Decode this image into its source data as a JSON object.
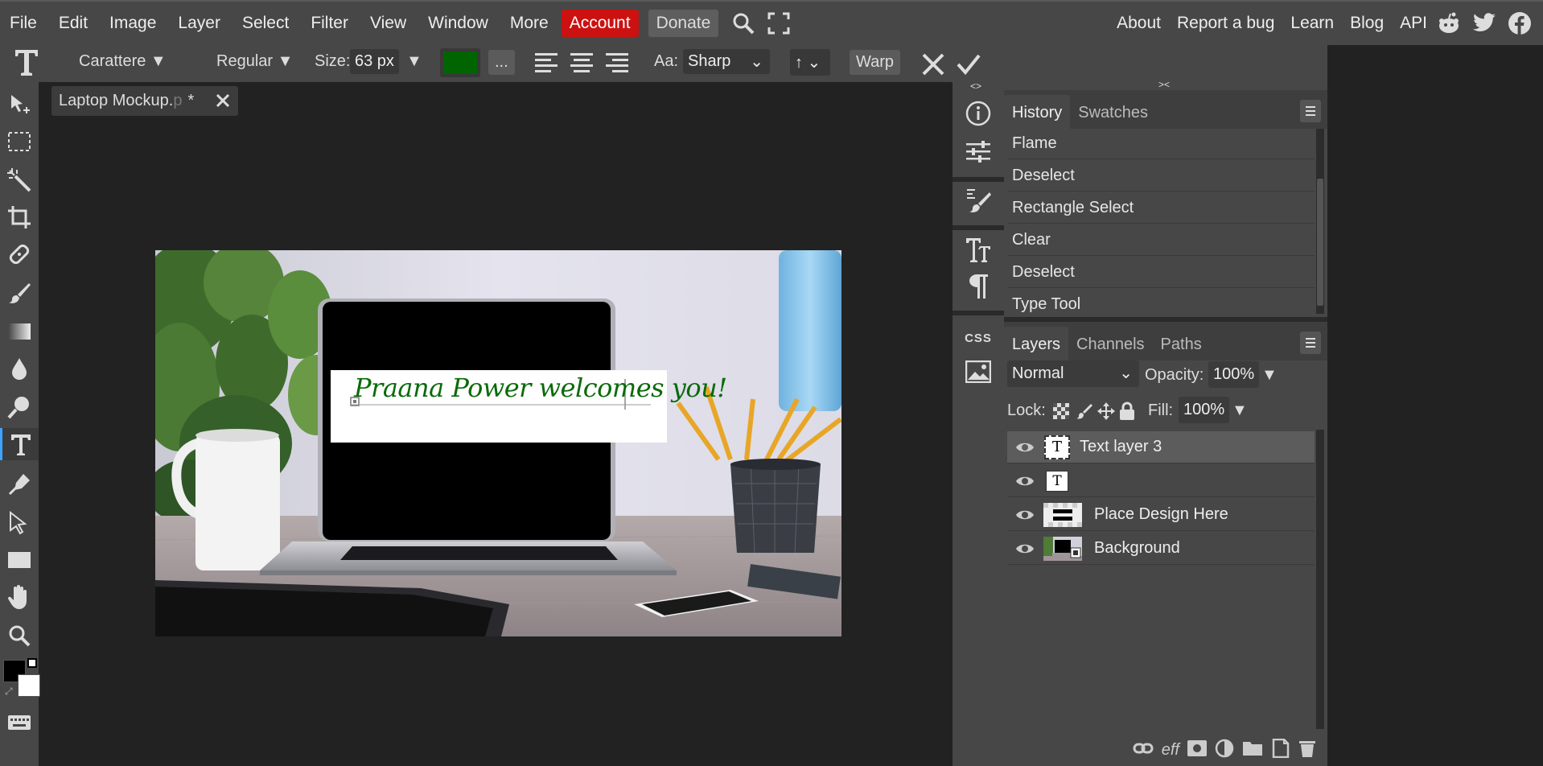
{
  "menubar": {
    "items": [
      "File",
      "Edit",
      "Image",
      "Layer",
      "Select",
      "Filter",
      "View",
      "Window",
      "More"
    ],
    "account_label": "Account",
    "donate_label": "Donate",
    "right_items": [
      "About",
      "Report a bug",
      "Learn",
      "Blog",
      "API"
    ]
  },
  "options": {
    "font_family": "Carattere",
    "font_style": "Regular",
    "size_label": "Size:",
    "size_value": "63 px",
    "color": "#006400",
    "more_label": "...",
    "aa_label": "Aa:",
    "aa_value": "Sharp",
    "direction": "↑",
    "warp_label": "Warp"
  },
  "document": {
    "tab_name": "Laptop Mockup.",
    "tab_ext": "p",
    "tab_modified": "*",
    "screen_text": "Praana Power welcomes you!"
  },
  "history": {
    "tabs": [
      "History",
      "Swatches"
    ],
    "items": [
      "Flame",
      "Deselect",
      "Rectangle Select",
      "Clear",
      "Deselect",
      "Type Tool"
    ]
  },
  "layers": {
    "tabs": [
      "Layers",
      "Channels",
      "Paths"
    ],
    "blend_mode": "Normal",
    "opacity_label": "Opacity:",
    "opacity_value": "100%",
    "lock_label": "Lock:",
    "fill_label": "Fill:",
    "fill_value": "100%",
    "rows": [
      {
        "name": "Text layer 3",
        "type": "text"
      },
      {
        "name": "",
        "type": "text"
      },
      {
        "name": "Place Design Here",
        "type": "smart"
      },
      {
        "name": "Background",
        "type": "image"
      }
    ]
  },
  "colors": {
    "foreground": "#000000",
    "background": "#ffffff",
    "accent": "#3da5ff",
    "account": "#cc1111"
  }
}
